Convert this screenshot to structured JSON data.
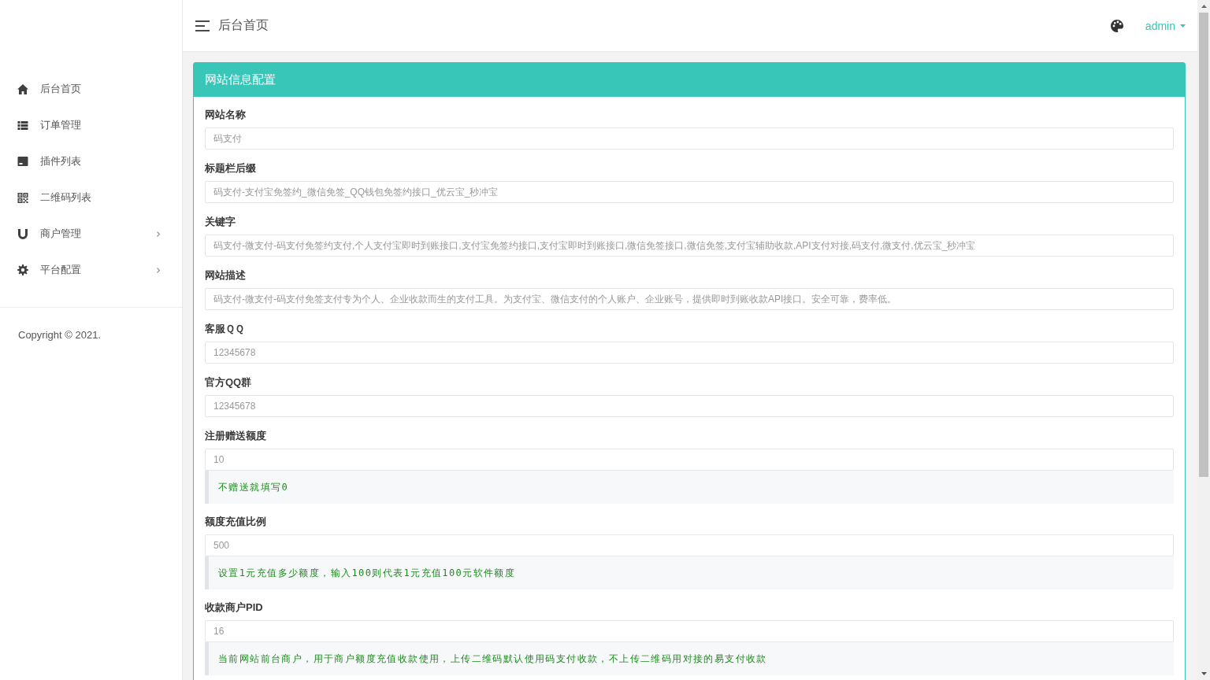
{
  "sidebar": {
    "items": [
      {
        "label": "后台首页",
        "submenu": false
      },
      {
        "label": "订单管理",
        "submenu": false
      },
      {
        "label": "插件列表",
        "submenu": false
      },
      {
        "label": "二维码列表",
        "submenu": false
      },
      {
        "label": "商户管理",
        "submenu": true
      },
      {
        "label": "平台配置",
        "submenu": true
      }
    ],
    "copyright": "Copyright © 2021."
  },
  "header": {
    "title": "后台首页",
    "user": "admin"
  },
  "panel": {
    "title": "网站信息配置",
    "fields": [
      {
        "label": "网站名称",
        "value": "码支付"
      },
      {
        "label": "标题栏后缀",
        "value": "码支付-支付宝免签约_微信免签_QQ钱包免签约接口_优云宝_秒冲宝"
      },
      {
        "label": "关键字",
        "value": "码支付-微支付-码支付免签约支付,个人支付宝即时到账接口,支付宝免签约接口,支付宝即时到账接口,微信免签接口,微信免签,支付宝辅助收款,API支付对接,码支付,微支付,优云宝_秒冲宝"
      },
      {
        "label": "网站描述",
        "value": "码支付-微支付-码支付免签支付专为个人、企业收款而生的支付工具。为支付宝、微信支付的个人账户、企业账号，提供即时到账收款API接口。安全可靠，费率低。"
      },
      {
        "label": "客服ＱＱ",
        "value": "12345678"
      },
      {
        "label": "官方QQ群",
        "value": "12345678"
      },
      {
        "label": "注册赠送额度",
        "value": "10",
        "hint": "不赠送就填写0"
      },
      {
        "label": "额度充值比例",
        "value": "500",
        "hint": "设置1元充值多少额度，输入100则代表1元充值100元软件额度"
      },
      {
        "label": "收款商户PID",
        "value": "16",
        "hint": "当前网站前台商户，用于商户额度充值收款使用，上传二维码默认使用码支付收款，不上传二维码用对接的易支付收款"
      }
    ]
  }
}
